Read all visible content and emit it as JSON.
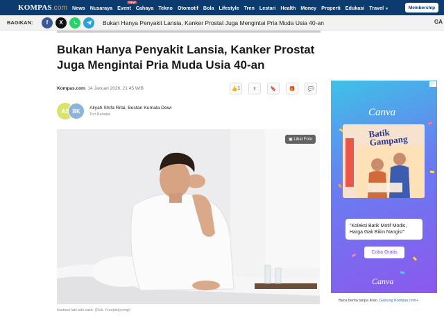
{
  "topnav": {
    "logo": "KOMPAS",
    "logo_suffix": ".com",
    "items": [
      "News",
      "Nusaraya",
      "Event",
      "Cahaya",
      "Tekno",
      "Otomotif",
      "Bola",
      "Lifestyle",
      "Tren",
      "Lestari",
      "Health",
      "Money",
      "Properti",
      "Edukasi",
      "Travel"
    ],
    "new_badge": "NEW",
    "membership_label": "Membership"
  },
  "sharebar": {
    "label": "BAGIKAN:",
    "title": "Bukan Hanya Penyakit Lansia, Kanker Prostat Juga Mengintai Pria Muda Usia 40-an",
    "icons": [
      "facebook-icon",
      "x-icon",
      "whatsapp-icon",
      "telegram-icon"
    ],
    "right_text": "GA"
  },
  "article": {
    "headline": "Bukan Hanya Penyakit Lansia, Kanker Prostat Juga Mengintai Pria Muda Usia 40-an",
    "source": "Kompas.com",
    "date": ", 14 Januari 2026, 21:45 WIB",
    "like_count": "1",
    "authors": "Aliyah Shifa Rifai,  Bestari Kumala Dewi",
    "author_role": "Tim Redaksi",
    "avatar1": "AS",
    "avatar2": "BK",
    "photo_button": "Lihat Foto",
    "caption": "Ilustrasi laki-laki sakit. (Dok. Freepik/jcomp)"
  },
  "ad": {
    "brand": "Canva",
    "card_title_1": "Batik",
    "card_title_2": "Gampang",
    "card_side": "KOLEKSI BATIK MODIS",
    "card_sub": "Koleksi Batik Motif Modis, Harga Gak Bikin Nangis",
    "quote": "\"Koleksi Batik Motif Modis, Harga Gak Bikin Nangis!\"",
    "button": "Coba Gratis",
    "note_prefix": "Baca berita tanpa iklan. ",
    "note_link": "Gabung Kompas.com+"
  }
}
